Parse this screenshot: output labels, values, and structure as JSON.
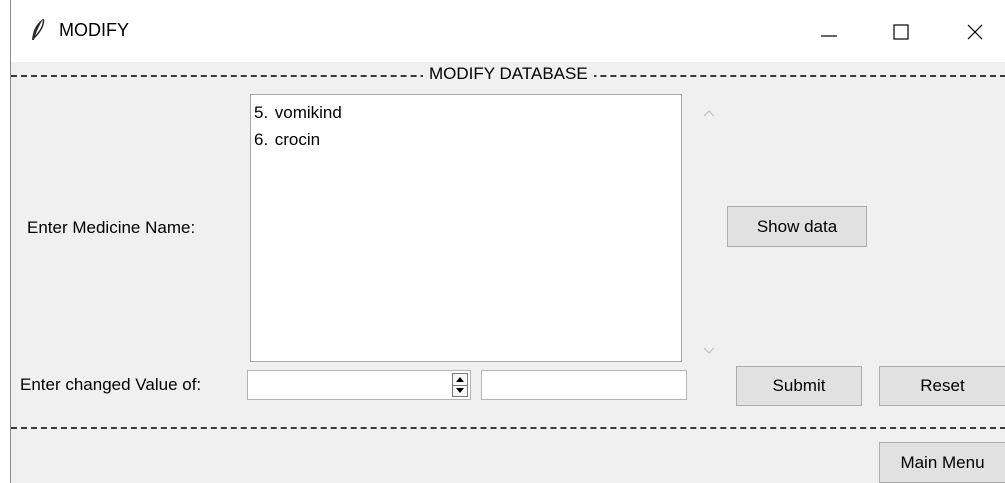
{
  "window": {
    "title": "MODIFY",
    "icon": "feather-icon"
  },
  "section": {
    "title": "MODIFY DATABASE"
  },
  "labels": {
    "medicine_name": "Enter Medicine Name:",
    "changed_value": "Enter changed Value of:"
  },
  "listbox": {
    "items": [
      {
        "num": "5.",
        "name": "vomikind"
      },
      {
        "num": "6.",
        "name": "crocin"
      }
    ]
  },
  "buttons": {
    "show_data": "Show data",
    "submit": "Submit",
    "reset": "Reset",
    "main_menu": "Main Menu"
  },
  "inputs": {
    "spinbox_value": "",
    "entry_value": ""
  }
}
